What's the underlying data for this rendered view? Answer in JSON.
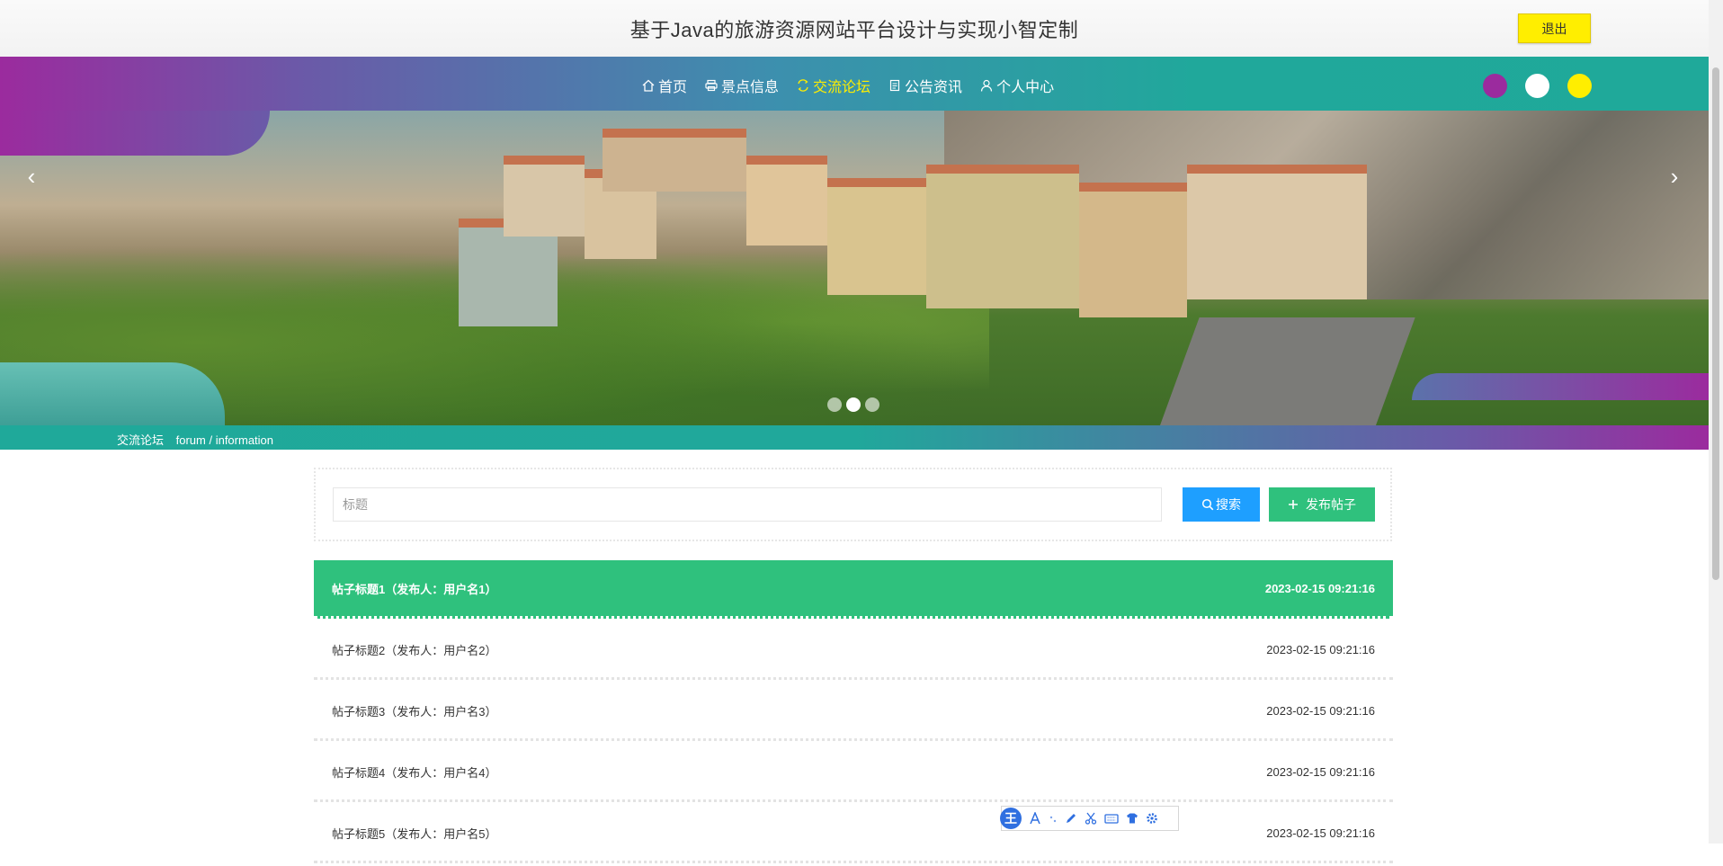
{
  "header": {
    "title": "基于Java的旅游资源网站平台设计与实现小智定制",
    "logout_label": "退出"
  },
  "nav": {
    "items": [
      {
        "label": "首页",
        "icon": "home-icon"
      },
      {
        "label": "景点信息",
        "icon": "printer-icon"
      },
      {
        "label": "交流论坛",
        "icon": "forum-icon",
        "active": true
      },
      {
        "label": "公告资讯",
        "icon": "document-icon"
      },
      {
        "label": "个人中心",
        "icon": "user-icon"
      }
    ],
    "active_color": "#ffee00",
    "theme_colors": [
      "#9b2b9e",
      "#ffffff",
      "#ffee00"
    ]
  },
  "banner": {
    "prev_arrow": "‹",
    "next_arrow": "›",
    "slide_count": 3,
    "active_slide": 2
  },
  "breadcrumb": {
    "title": "交流论坛",
    "path": "forum / information"
  },
  "search": {
    "placeholder": "标题",
    "search_label": "搜索",
    "post_label": "发布帖子"
  },
  "posts": [
    {
      "title": "帖子标题1（发布人：用户名1）",
      "time": "2023-02-15 09:21:16"
    },
    {
      "title": "帖子标题2（发布人：用户名2）",
      "time": "2023-02-15 09:21:16"
    },
    {
      "title": "帖子标题3（发布人：用户名3）",
      "time": "2023-02-15 09:21:16"
    },
    {
      "title": "帖子标题4（发布人：用户名4）",
      "time": "2023-02-15 09:21:16"
    },
    {
      "title": "帖子标题5（发布人：用户名5）",
      "time": "2023-02-15 09:21:16"
    }
  ],
  "ime": {
    "logo": "王"
  },
  "colors": {
    "primary_green": "#2fc17d",
    "search_blue": "#1e9fff",
    "logout_yellow": "#ffee00"
  }
}
